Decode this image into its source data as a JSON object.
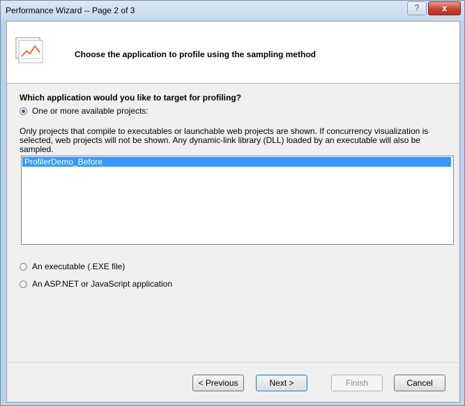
{
  "window": {
    "title": "Performance Wizard -- Page 2 of 3"
  },
  "titlebar_buttons": {
    "help_glyph": "?",
    "close_glyph": "x"
  },
  "header": {
    "text": "Choose the application to profile using the sampling method"
  },
  "question": "Which application would you like to target for profiling?",
  "options": {
    "projects": {
      "label": "One or more available projects:",
      "selected": true
    },
    "exe": {
      "label": "An executable (.EXE file)",
      "selected": false
    },
    "aspnet": {
      "label": "An ASP.NET or JavaScript application",
      "selected": false
    }
  },
  "description": "Only projects that compile to executables or launchable web projects are shown. If concurrency visualization is selected, web projects will not be shown. Any dynamic-link library (DLL) loaded by an executable will also be sampled.",
  "project_list": {
    "items": [
      "ProfilerDemo_Before"
    ],
    "selected_index": 0
  },
  "buttons": {
    "previous": "< Previous",
    "next": "Next >",
    "finish": "Finish",
    "cancel": "Cancel"
  },
  "colors": {
    "selection": "#3399ff",
    "close": "#c7412f",
    "radio_dot": "#2c5d8e"
  },
  "icons": {
    "header": "performance-chart-icon"
  }
}
